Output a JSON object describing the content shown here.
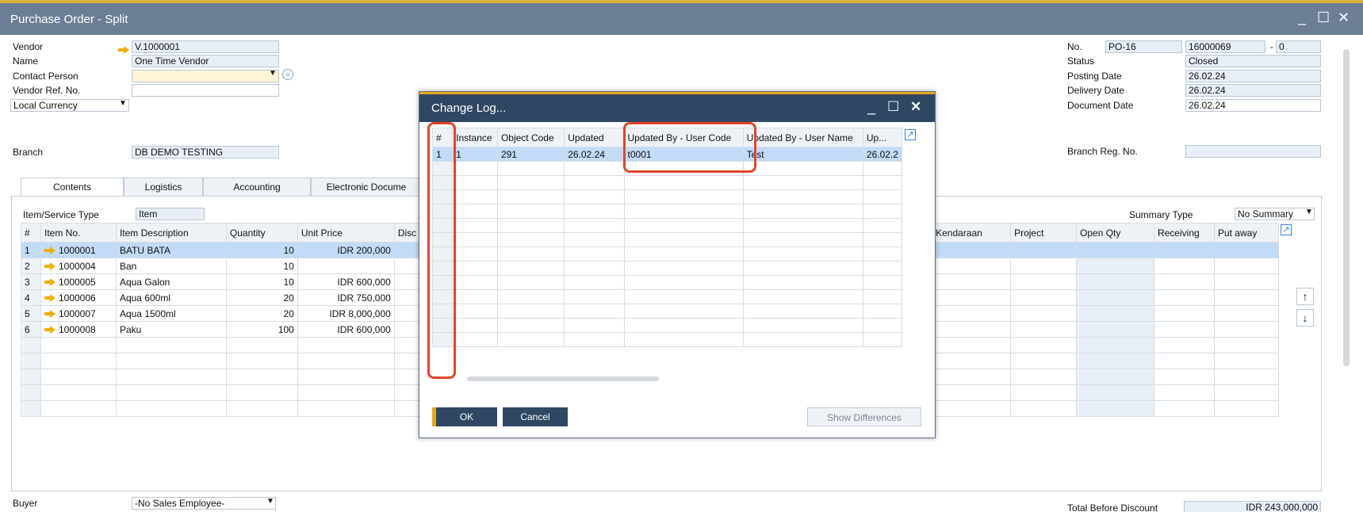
{
  "window": {
    "title": "Purchase Order - Split",
    "min": "_",
    "max": "☐",
    "close": "✕"
  },
  "header_left": {
    "vendor_label": "Vendor",
    "vendor_value": "V.1000001",
    "name_label": "Name",
    "name_value": "One Time Vendor",
    "contact_label": "Contact Person",
    "contact_value": "",
    "vendor_ref_label": "Vendor Ref. No.",
    "vendor_ref_value": "",
    "currency_label": "Local Currency",
    "branch_label": "Branch",
    "branch_value": "DB DEMO TESTING"
  },
  "header_right": {
    "no_label": "No.",
    "series": "PO-16",
    "number": "16000069",
    "dash": "-",
    "suffix": "0",
    "status_label": "Status",
    "status_value": "Closed",
    "posting_label": "Posting Date",
    "posting_value": "26.02.24",
    "delivery_label": "Delivery Date",
    "delivery_value": "26.02.24",
    "document_label": "Document Date",
    "document_value": "26.02.24",
    "branch_reg_label": "Branch Reg. No.",
    "branch_reg_value": ""
  },
  "tabs": [
    "Contents",
    "Logistics",
    "Accounting",
    "Electronic Docume"
  ],
  "contents": {
    "item_type_label": "Item/Service Type",
    "item_type_value": "Item",
    "summary_label": "Summary Type",
    "summary_value": "No Summary",
    "columns_left": [
      "#",
      "Item No.",
      "Item Description",
      "Quantity",
      "Unit Price",
      "Disc"
    ],
    "columns_right": [
      "Kendaraan",
      "Project",
      "Open Qty",
      "Receiving",
      "Put away"
    ],
    "rows": [
      {
        "n": "1",
        "item": "1000001",
        "desc": "BATU BATA",
        "qty": "10",
        "price": "IDR 200,000"
      },
      {
        "n": "2",
        "item": "1000004",
        "desc": "Ban",
        "qty": "10",
        "price": ""
      },
      {
        "n": "3",
        "item": "1000005",
        "desc": "Aqua Galon",
        "qty": "10",
        "price": "IDR 600,000"
      },
      {
        "n": "4",
        "item": "1000006",
        "desc": "Aqua 600ml",
        "qty": "20",
        "price": "IDR 750,000"
      },
      {
        "n": "5",
        "item": "1000007",
        "desc": "Aqua 1500ml",
        "qty": "20",
        "price": "IDR 8,000,000"
      },
      {
        "n": "6",
        "item": "1000008",
        "desc": "Paku",
        "qty": "100",
        "price": "IDR 600,000"
      }
    ]
  },
  "footer": {
    "buyer_label": "Buyer",
    "buyer_value": "-No Sales Employee-",
    "total_label": "Total Before Discount",
    "total_value": "IDR 243,000,000"
  },
  "dialog": {
    "title": "Change Log...",
    "columns": [
      "#",
      "Instance",
      "Object Code",
      "Updated",
      "Updated By - User Code",
      "Updated By - User Name",
      "Up..."
    ],
    "rows": [
      {
        "n": "1",
        "instance": "1",
        "object_code": "291",
        "updated": "26.02.24",
        "user_code": "t0001",
        "user_name": "Test",
        "up": "26.02.2"
      }
    ],
    "ok": "OK",
    "cancel": "Cancel",
    "show_diff": "Show Differences"
  }
}
